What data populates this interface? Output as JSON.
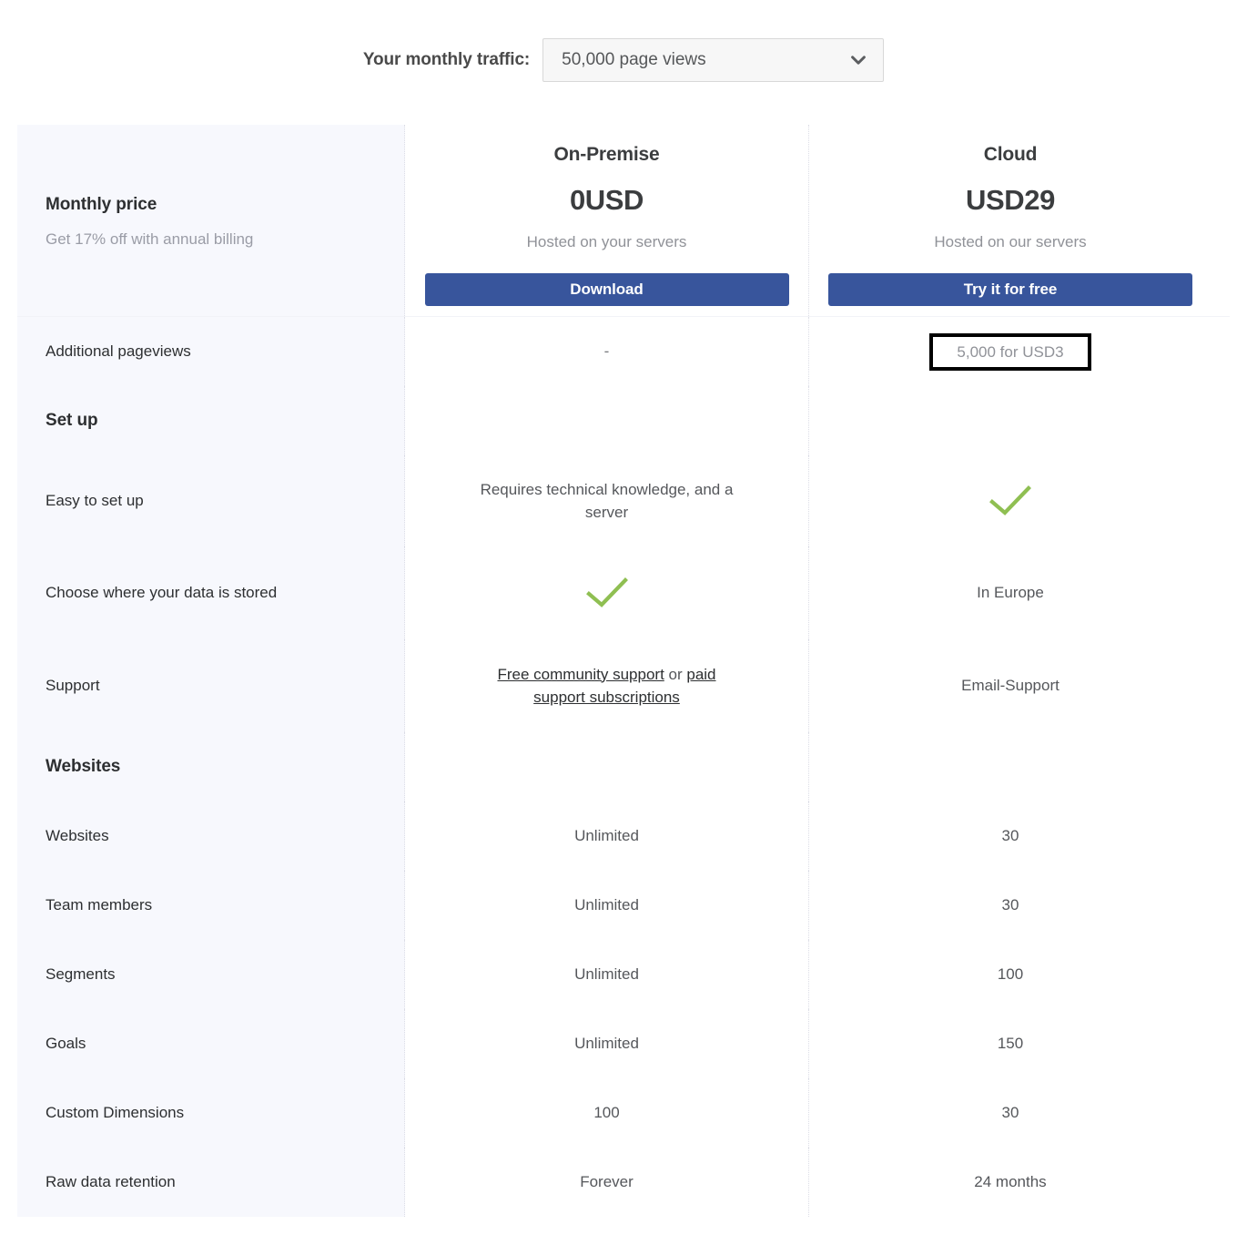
{
  "traffic": {
    "label": "Your monthly traffic:",
    "selected": "50,000 page views",
    "icon": "chevron-down-icon"
  },
  "plans": {
    "on_premise": {
      "name": "On-Premise",
      "price": "0USD",
      "hosting": "Hosted on your servers",
      "cta": "Download"
    },
    "cloud": {
      "name": "Cloud",
      "price": "USD29",
      "hosting": "Hosted on our servers",
      "cta": "Try it for free"
    }
  },
  "rows": {
    "monthly_price": {
      "label": "Monthly price",
      "sub": "Get 17% off with annual billing"
    },
    "additional_pageviews": {
      "label": "Additional pageviews",
      "on_premise": "-",
      "cloud": "5,000 for USD3"
    },
    "section_setup": {
      "label": "Set up"
    },
    "easy_setup": {
      "label": "Easy to set up",
      "on_premise": "Requires technical knowledge, and a server",
      "cloud": "check-icon"
    },
    "data_location": {
      "label": "Choose where your data is stored",
      "on_premise": "check-icon",
      "cloud": "In Europe"
    },
    "support": {
      "label": "Support",
      "on_premise_link1": "Free community support",
      "on_premise_or": " or ",
      "on_premise_link2": "paid support subscriptions",
      "cloud": "Email-Support"
    },
    "section_websites": {
      "label": "Websites"
    },
    "websites": {
      "label": "Websites",
      "on_premise": "Unlimited",
      "cloud": "30"
    },
    "team_members": {
      "label": "Team members",
      "on_premise": "Unlimited",
      "cloud": "30"
    },
    "segments": {
      "label": "Segments",
      "on_premise": "Unlimited",
      "cloud": "100"
    },
    "goals": {
      "label": "Goals",
      "on_premise": "Unlimited",
      "cloud": "150"
    },
    "custom_dimensions": {
      "label": "Custom Dimensions",
      "on_premise": "100",
      "cloud": "30"
    },
    "raw_data_retention": {
      "label": "Raw data retention",
      "on_premise": "Forever",
      "cloud": "24 months"
    }
  },
  "colors": {
    "accent_blue": "#38559c",
    "check_green": "#8fbf52",
    "sidebar_bg": "#f7f8fd",
    "highlight_ring": "#000000"
  }
}
